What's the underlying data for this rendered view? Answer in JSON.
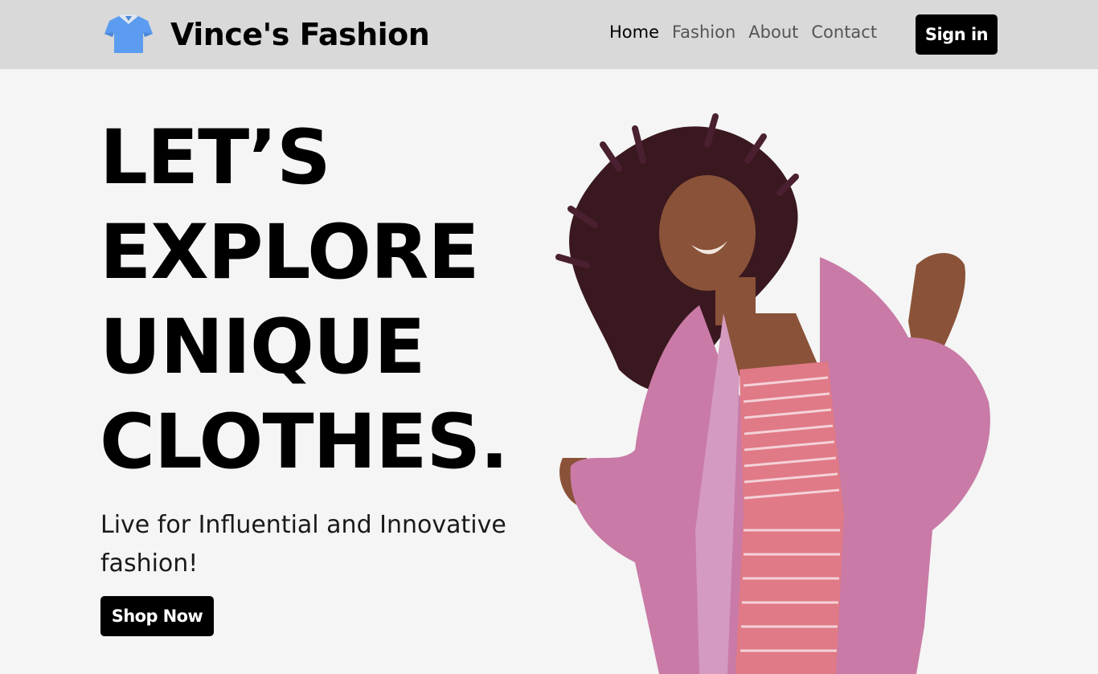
{
  "brand": {
    "name": "Vince's Fashion",
    "icon": "shirt-icon"
  },
  "nav": {
    "items": [
      {
        "label": "Home",
        "active": true
      },
      {
        "label": "Fashion",
        "active": false
      },
      {
        "label": "About",
        "active": false
      },
      {
        "label": "Contact",
        "active": false
      }
    ],
    "signin_label": "Sign in"
  },
  "hero": {
    "title_lines": [
      "LET’S",
      "EXPLORE",
      "UNIQUE",
      "CLOTHES."
    ],
    "subtitle": "Live for Influential and Innovative fashion!",
    "cta_label": "Shop Now",
    "image": "model-in-pink-fur-coat"
  },
  "colors": {
    "navbar_bg": "#d9d9d9",
    "page_bg": "#f4f5f4",
    "button_bg": "#000000",
    "shirt_icon": "#5b9cf0",
    "coat": "#c97aa6"
  }
}
